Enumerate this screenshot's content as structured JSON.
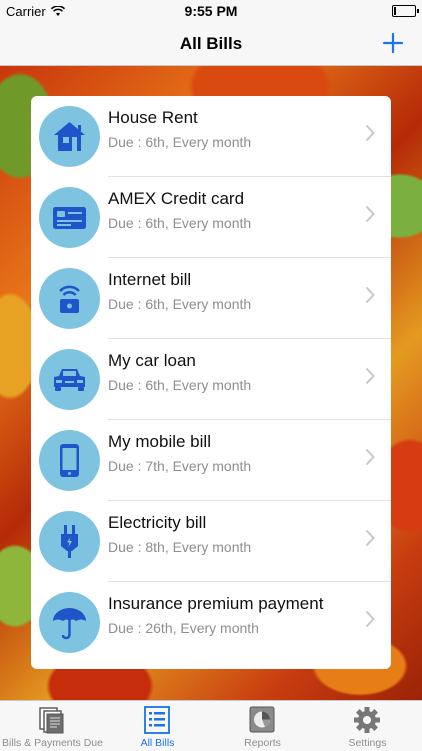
{
  "status_bar": {
    "carrier": "Carrier",
    "time": "9:55 PM",
    "wifi_icon": "wifi-icon",
    "battery_icon": "battery-icon"
  },
  "nav": {
    "title": "All Bills",
    "add_icon": "plus-icon"
  },
  "bills": [
    {
      "title": "House Rent",
      "subtitle": "Due : 6th, Every month",
      "icon": "house-icon"
    },
    {
      "title": "AMEX Credit card",
      "subtitle": "Due : 6th, Every month",
      "icon": "credit-card-icon"
    },
    {
      "title": "Internet bill",
      "subtitle": "Due : 6th, Every month",
      "icon": "router-icon"
    },
    {
      "title": "My car loan",
      "subtitle": "Due : 6th, Every month",
      "icon": "car-icon"
    },
    {
      "title": "My mobile bill",
      "subtitle": "Due : 7th, Every month",
      "icon": "mobile-phone-icon"
    },
    {
      "title": "Electricity bill",
      "subtitle": "Due : 8th, Every month",
      "icon": "plug-icon"
    },
    {
      "title": "Insurance premium payment",
      "subtitle": "Due : 26th, Every month",
      "icon": "umbrella-icon"
    }
  ],
  "tabs": [
    {
      "label": "Bills & Payments Due",
      "icon": "documents-icon",
      "active": false
    },
    {
      "label": "All Bills",
      "icon": "list-icon",
      "active": true
    },
    {
      "label": "Reports",
      "icon": "pie-chart-icon",
      "active": false
    },
    {
      "label": "Settings",
      "icon": "gear-icon",
      "active": false
    }
  ],
  "colors": {
    "accent": "#1a73e8",
    "icon_circle": "#7ec4e0",
    "icon_glyph": "#1f55c9",
    "subtitle": "#8e8e93"
  }
}
